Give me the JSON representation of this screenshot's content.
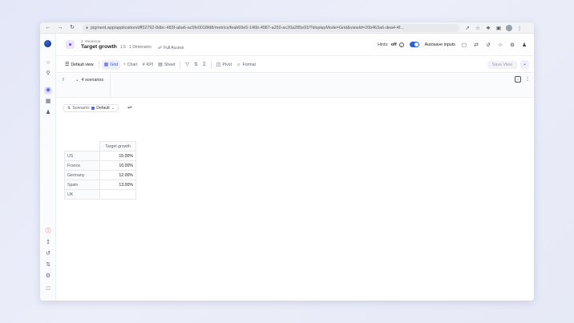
{
  "browser": {
    "url": "pigment.app/application/dff32792-8dbc-483f-aba6-ac5fe0018fd8/metrics/feab69e5-146b-4987-a250-ac20a285e91f?displayMode=Grid&viewId=20b463a6-dea4-4f..."
  },
  "header": {
    "breadcrumb": "2. Revenue",
    "title": "Target growth",
    "dimension_info": "1.5 · 1 Dimension",
    "access": "Full Access",
    "hints_label": "Hints:",
    "hints_value": "off",
    "autosave_label": "Autosave inputs"
  },
  "toolbar": {
    "default_view": "Default view",
    "grid": "Grid",
    "chart": "Chart",
    "kpi": "KPI",
    "sheet": "Sheet",
    "pivot": "Pivot",
    "format": "Format",
    "save_view": "Save View"
  },
  "filter": {
    "fx": "f",
    "scenarios": "4 scenarios"
  },
  "scenario_select": {
    "label": "Scenario:",
    "value": "Default"
  },
  "table": {
    "column_header": "Target growth",
    "rows": [
      {
        "label": "US",
        "value": "15.00%"
      },
      {
        "label": "France",
        "value": "10.00%"
      },
      {
        "label": "Germany",
        "value": "12.00%"
      },
      {
        "label": "Spain",
        "value": "13.00%"
      },
      {
        "label": "UK",
        "value": ""
      }
    ]
  },
  "colors": {
    "accent": "#3d50d8",
    "toggle_on": "#2b5fd9",
    "alert": "#d93b3b"
  }
}
